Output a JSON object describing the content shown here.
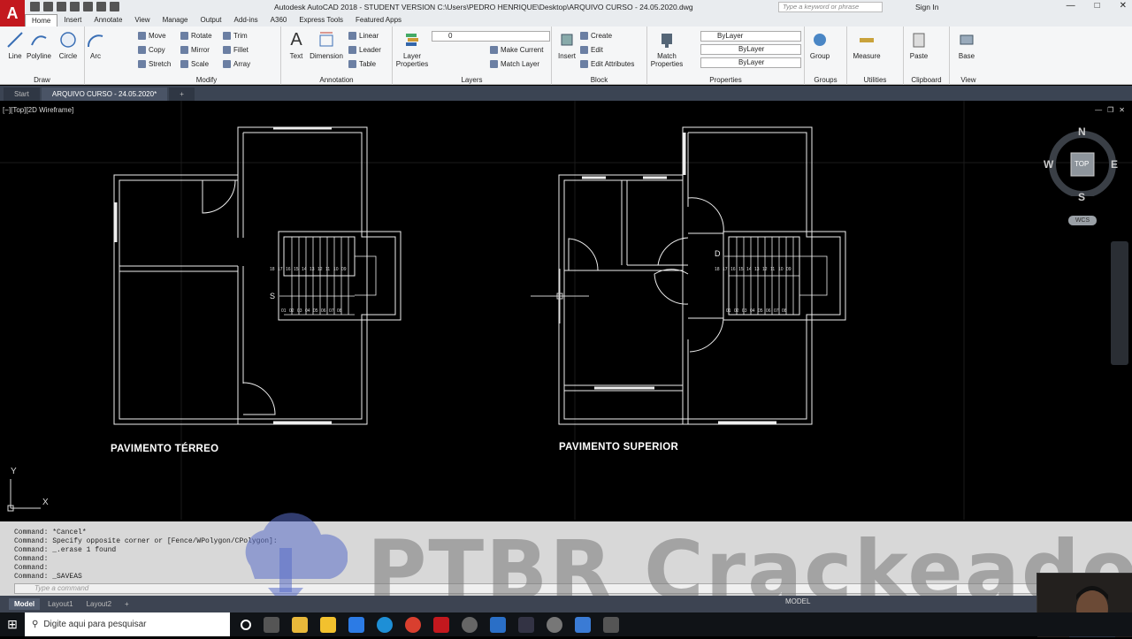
{
  "window": {
    "title": "Autodesk AutoCAD 2018 - STUDENT VERSION    C:\\Users\\PEDRO HENRIQUE\\Desktop\\ARQUIVO CURSO - 24.05.2020.dwg",
    "search_placeholder": "Type a keyword or phrase",
    "sign_in": "Sign In",
    "app_letter": "A"
  },
  "ribbon_tabs": [
    "Home",
    "Insert",
    "Annotate",
    "View",
    "Manage",
    "Output",
    "Add-ins",
    "A360",
    "Express Tools",
    "Featured Apps"
  ],
  "ribbon": {
    "draw": {
      "title": "Draw",
      "line": "Line",
      "polyline": "Polyline",
      "circle": "Circle",
      "arc": "Arc"
    },
    "modify": {
      "title": "Modify",
      "move": "Move",
      "rotate": "Rotate",
      "trim": "Trim",
      "copy": "Copy",
      "mirror": "Mirror",
      "fillet": "Fillet",
      "stretch": "Stretch",
      "scale": "Scale",
      "array": "Array"
    },
    "annotation": {
      "title": "Annotation",
      "text": "Text",
      "dimension": "Dimension",
      "linear": "Linear",
      "leader": "Leader",
      "table": "Table"
    },
    "layers": {
      "title": "Layers",
      "layer_properties": "Layer Properties",
      "layer_value": "0",
      "make_current": "Make Current",
      "match_layer": "Match Layer"
    },
    "block": {
      "title": "Block",
      "insert": "Insert",
      "create": "Create",
      "edit": "Edit",
      "edit_attributes": "Edit Attributes"
    },
    "properties": {
      "title": "Properties",
      "match_properties": "Match Properties",
      "color": "ByLayer",
      "linetype": "ByLayer",
      "lineweight": "ByLayer"
    },
    "groups": {
      "title": "Groups",
      "group": "Group"
    },
    "utilities": {
      "title": "Utilities",
      "measure": "Measure"
    },
    "clipboard": {
      "title": "Clipboard",
      "paste": "Paste"
    },
    "view": {
      "title": "View",
      "base": "Base"
    }
  },
  "document_tabs": [
    "Start",
    "ARQUIVO CURSO - 24.05.2020*"
  ],
  "viewport": {
    "label": "[−][Top][2D Wireframe]",
    "compass": {
      "n": "N",
      "s": "S",
      "e": "E",
      "w": "W",
      "top": "TOP",
      "wcs": "WCS"
    },
    "ucs_x": "X",
    "ucs_y": "Y"
  },
  "drawing": {
    "left_title": "PAVIMENTO TÉRREO",
    "right_title": "PAVIMENTO SUPERIOR",
    "stair_up_label": "S",
    "stair_down_label": "D",
    "stair_top_numbers": [
      "18",
      "17",
      "16",
      "15",
      "14",
      "13",
      "12",
      "11",
      "10",
      "09"
    ],
    "stair_bottom_numbers": [
      "01",
      "02",
      "03",
      "04",
      "05",
      "06",
      "07",
      "08"
    ]
  },
  "command": {
    "history": [
      "Command: *Cancel*",
      "Command: Specify opposite corner or [Fence/WPolygon/CPolygon]:",
      "Command: _.erase 1 found",
      "Command:",
      "Command:",
      "Command: _SAVEAS"
    ],
    "placeholder": "Type a command"
  },
  "layout_tabs": [
    "Model",
    "Layout1",
    "Layout2"
  ],
  "status": {
    "space": "MODEL"
  },
  "taskbar": {
    "search_placeholder": "Digite aqui para pesquisar"
  },
  "watermark": "PTBR Crackeado",
  "colors": {
    "accent": "#c3181e",
    "viewport": "#000000",
    "ribbon": "#f5f6f7",
    "doc_tabs": "#3b4453"
  }
}
